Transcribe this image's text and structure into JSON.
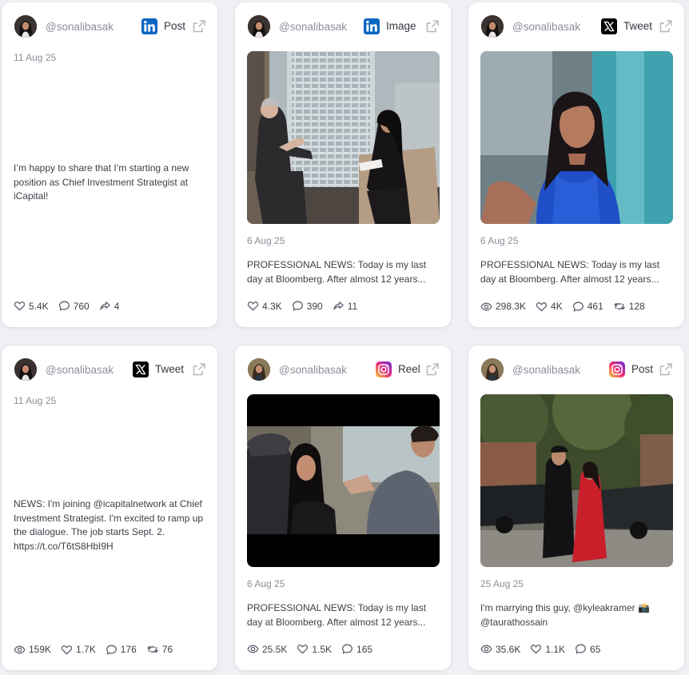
{
  "cards": [
    {
      "handle": "@sonalibasak",
      "platform": "linkedin",
      "type_label": "Post",
      "date": "11 Aug 25",
      "text": "I’m happy to share that I’m starting a new position as Chief Investment Strategist at iCapital!",
      "stats": {
        "likes": "5.4K",
        "comments": "760",
        "shares": "4"
      }
    },
    {
      "handle": "@sonalibasak",
      "platform": "linkedin",
      "type_label": "Image",
      "date": "6 Aug 25",
      "line1": "PROFESSIONAL NEWS: Today is my last",
      "line2": "day at Bloomberg. After almost 12 years...",
      "stats": {
        "likes": "4.3K",
        "comments": "390",
        "shares": "11"
      }
    },
    {
      "handle": "@sonalibasak",
      "platform": "x",
      "type_label": "Tweet",
      "date": "6 Aug 25",
      "line1": "PROFESSIONAL NEWS: Today is my last",
      "line2": "day at Bloomberg. After almost 12 years...",
      "stats": {
        "views": "298.3K",
        "likes": "4K",
        "comments": "461",
        "retweets": "128"
      }
    },
    {
      "handle": "@sonalibasak",
      "platform": "x",
      "type_label": "Tweet",
      "date": "11 Aug 25",
      "text": "NEWS: I'm joining @icapitalnetwork at Chief Investment Strategist. I'm excited to ramp up the dialogue. The job starts Sept. 2. https://t.co/T6tS8HbI9H",
      "stats": {
        "views": "159K",
        "likes": "1.7K",
        "comments": "176",
        "retweets": "76"
      }
    },
    {
      "handle": "@sonalibasak",
      "platform": "instagram",
      "type_label": "Reel",
      "date": "6 Aug 25",
      "line1": "PROFESSIONAL NEWS: Today is my last",
      "line2": "day at Bloomberg. After almost 12 years...",
      "stats": {
        "views": "25.5K",
        "likes": "1.5K",
        "comments": "165"
      }
    },
    {
      "handle": "@sonalibasak",
      "platform": "instagram",
      "type_label": "Post",
      "date": "25 Aug 25",
      "line1": "I'm marrying this guy, @kyleakramer 📸",
      "line2": "@taurathossain",
      "stats": {
        "views": "35.6K",
        "likes": "1.1K",
        "comments": "65"
      }
    }
  ],
  "colors": {
    "linkedin": "#0a66c2",
    "x": "#000000",
    "instagram_gradient": [
      "#f9ce34",
      "#ee2a7b",
      "#6228d7"
    ],
    "icon_gray": "#5f6470"
  },
  "icons": {
    "open_external": "external-link-icon",
    "likes": "heart-icon",
    "comments": "comment-icon",
    "shares": "share-icon",
    "views": "eye-icon",
    "retweets": "retweet-icon"
  }
}
